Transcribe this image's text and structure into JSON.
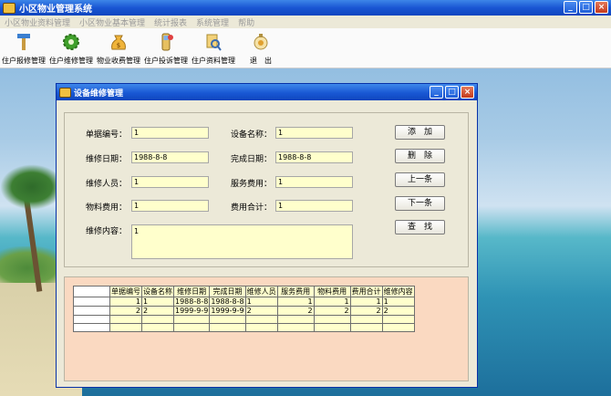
{
  "window": {
    "title": "小区物业管理系统",
    "min": "_",
    "max": "□",
    "close": "×"
  },
  "menu": [
    "小区物业资料管理",
    "小区物业基本管理",
    "统计报表",
    "系统管理",
    "帮助"
  ],
  "toolbar": [
    {
      "label": "住户报修管理",
      "icon": "hammer-icon"
    },
    {
      "label": "住户维修管理",
      "icon": "gear-icon"
    },
    {
      "label": "物业收费管理",
      "icon": "money-bag-icon"
    },
    {
      "label": "住户投诉管理",
      "icon": "phone-icon"
    },
    {
      "label": "住户资料管理",
      "icon": "magnifier-icon"
    },
    {
      "label": "退　出",
      "icon": "exit-icon"
    }
  ],
  "dialog": {
    "title": "设备维修管理",
    "fields": {
      "order_no": {
        "label": "单据编号：",
        "value": "1"
      },
      "device_name": {
        "label": "设备名称：",
        "value": "1"
      },
      "repair_date": {
        "label": "维修日期：",
        "value": "1988-8-8"
      },
      "finish_date": {
        "label": "完成日期：",
        "value": "1988-8-8"
      },
      "repairer": {
        "label": "维修人员：",
        "value": "1"
      },
      "service_fee": {
        "label": "服务费用：",
        "value": "1"
      },
      "material_fee": {
        "label": "物料费用：",
        "value": "1"
      },
      "total_fee": {
        "label": "费用合计：",
        "value": "1"
      },
      "content": {
        "label": "维修内容：",
        "value": "1"
      }
    },
    "buttons": {
      "add": "添　加",
      "delete": "删　除",
      "prev": "上一条",
      "next": "下一条",
      "find": "查　找"
    },
    "grid": {
      "headers": [
        "单据编号",
        "设备名称",
        "维修日期",
        "完成日期",
        "维修人员",
        "服务费用",
        "物料费用",
        "费用合计",
        "维修内容"
      ],
      "rows": [
        [
          "1",
          "1",
          "1988-8-8",
          "1988-8-8",
          "1",
          "1",
          "1",
          "1",
          "1"
        ],
        [
          "2",
          "2",
          "1999-9-9",
          "1999-9-9",
          "2",
          "2",
          "2",
          "2",
          "2"
        ]
      ]
    }
  }
}
